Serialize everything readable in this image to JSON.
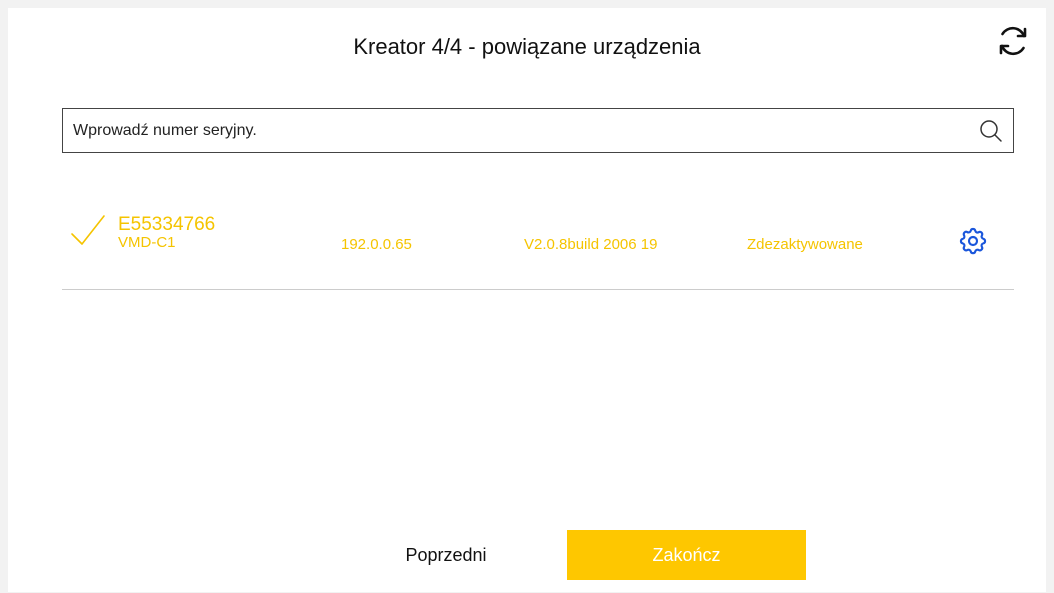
{
  "header": {
    "title": "Kreator 4/4 - powiązane urządzenia",
    "refresh_icon": "refresh-icon"
  },
  "search": {
    "placeholder": "Wprowadź numer seryjny.",
    "value": "",
    "icon": "search-icon"
  },
  "devices": [
    {
      "checked": true,
      "serial": "E55334766",
      "model": "VMD-C1",
      "ip": "192.0.0.65",
      "version": "V2.0.8build 2006 19",
      "status": "Zdezaktywowane",
      "settings_icon": "gear-icon"
    }
  ],
  "footer": {
    "prev_label": "Poprzedni",
    "finish_label": "Zakończ"
  },
  "colors": {
    "accent_yellow": "#fec700",
    "device_text": "#f5c400",
    "settings_icon_blue": "#1a56db"
  }
}
